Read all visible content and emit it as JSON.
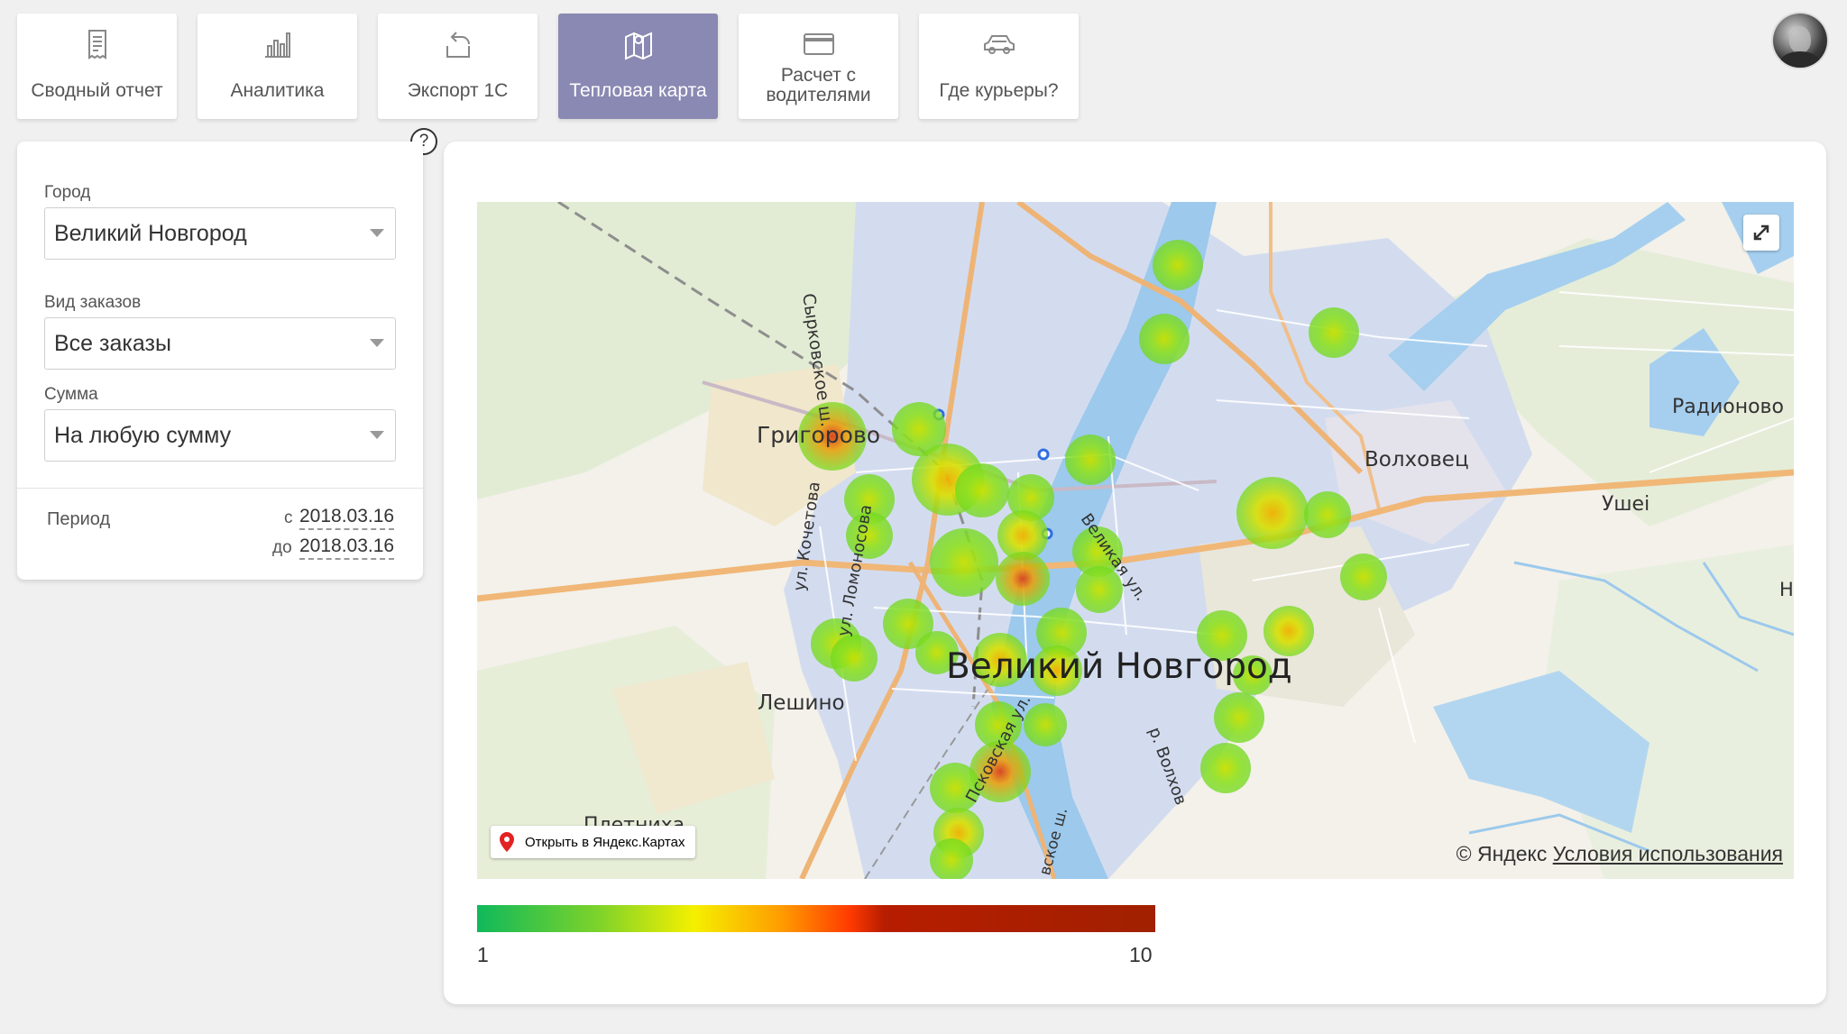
{
  "nav": {
    "tabs": [
      {
        "label": "Сводный отчет",
        "icon": "report-icon",
        "active": false
      },
      {
        "label": "Аналитика",
        "icon": "bar-chart-icon",
        "active": false
      },
      {
        "label": "Экспорт 1С",
        "icon": "export-icon",
        "active": false
      },
      {
        "label": "Тепловая карта",
        "icon": "map-pin-icon",
        "active": true
      },
      {
        "label": "Расчет с\nводителями",
        "icon": "credit-card-icon",
        "active": false
      },
      {
        "label": "Где курьеры?",
        "icon": "car-icon",
        "active": false
      }
    ],
    "active_color": "#8a89b3"
  },
  "help": {
    "symbol": "?"
  },
  "filters": {
    "city": {
      "label": "Город",
      "value": "Великий Новгород"
    },
    "order_type": {
      "label": "Вид заказов",
      "value": "Все заказы"
    },
    "amount": {
      "label": "Сумма",
      "value": "На любую сумму"
    },
    "period": {
      "label": "Период",
      "from_prefix": "с",
      "from": "2018.03.16",
      "to_prefix": "до",
      "to": "2018.03.16"
    }
  },
  "map": {
    "place_labels": {
      "grigorovo": "Григорово",
      "volkhovets": "Волховец",
      "radionovo": "Радионово",
      "ushei": "Ушеі",
      "n": "Н",
      "leshino": "Лешино",
      "pletnikha": "Плетниха",
      "city": "Великий Новгород"
    },
    "street_labels": {
      "syrkovskoe": "Сырковское ш.",
      "kochetova": "ул. Кочетова",
      "lomonosova": "ул. Ломоносова",
      "velikaya": "Великая ул.",
      "volkhov": "р. Волхов",
      "pskovskaya": "Псковская ул.",
      "vskoe": "вское ш."
    },
    "open_in_yandex": "Открыть в Яндекс.Картах",
    "copyright": "© Яндекс",
    "terms_link": "Условия использования"
  },
  "legend": {
    "min": "1",
    "max": "10",
    "colors": [
      "#0fb95b",
      "#f5f000",
      "#ff3a00",
      "#a02000"
    ]
  }
}
